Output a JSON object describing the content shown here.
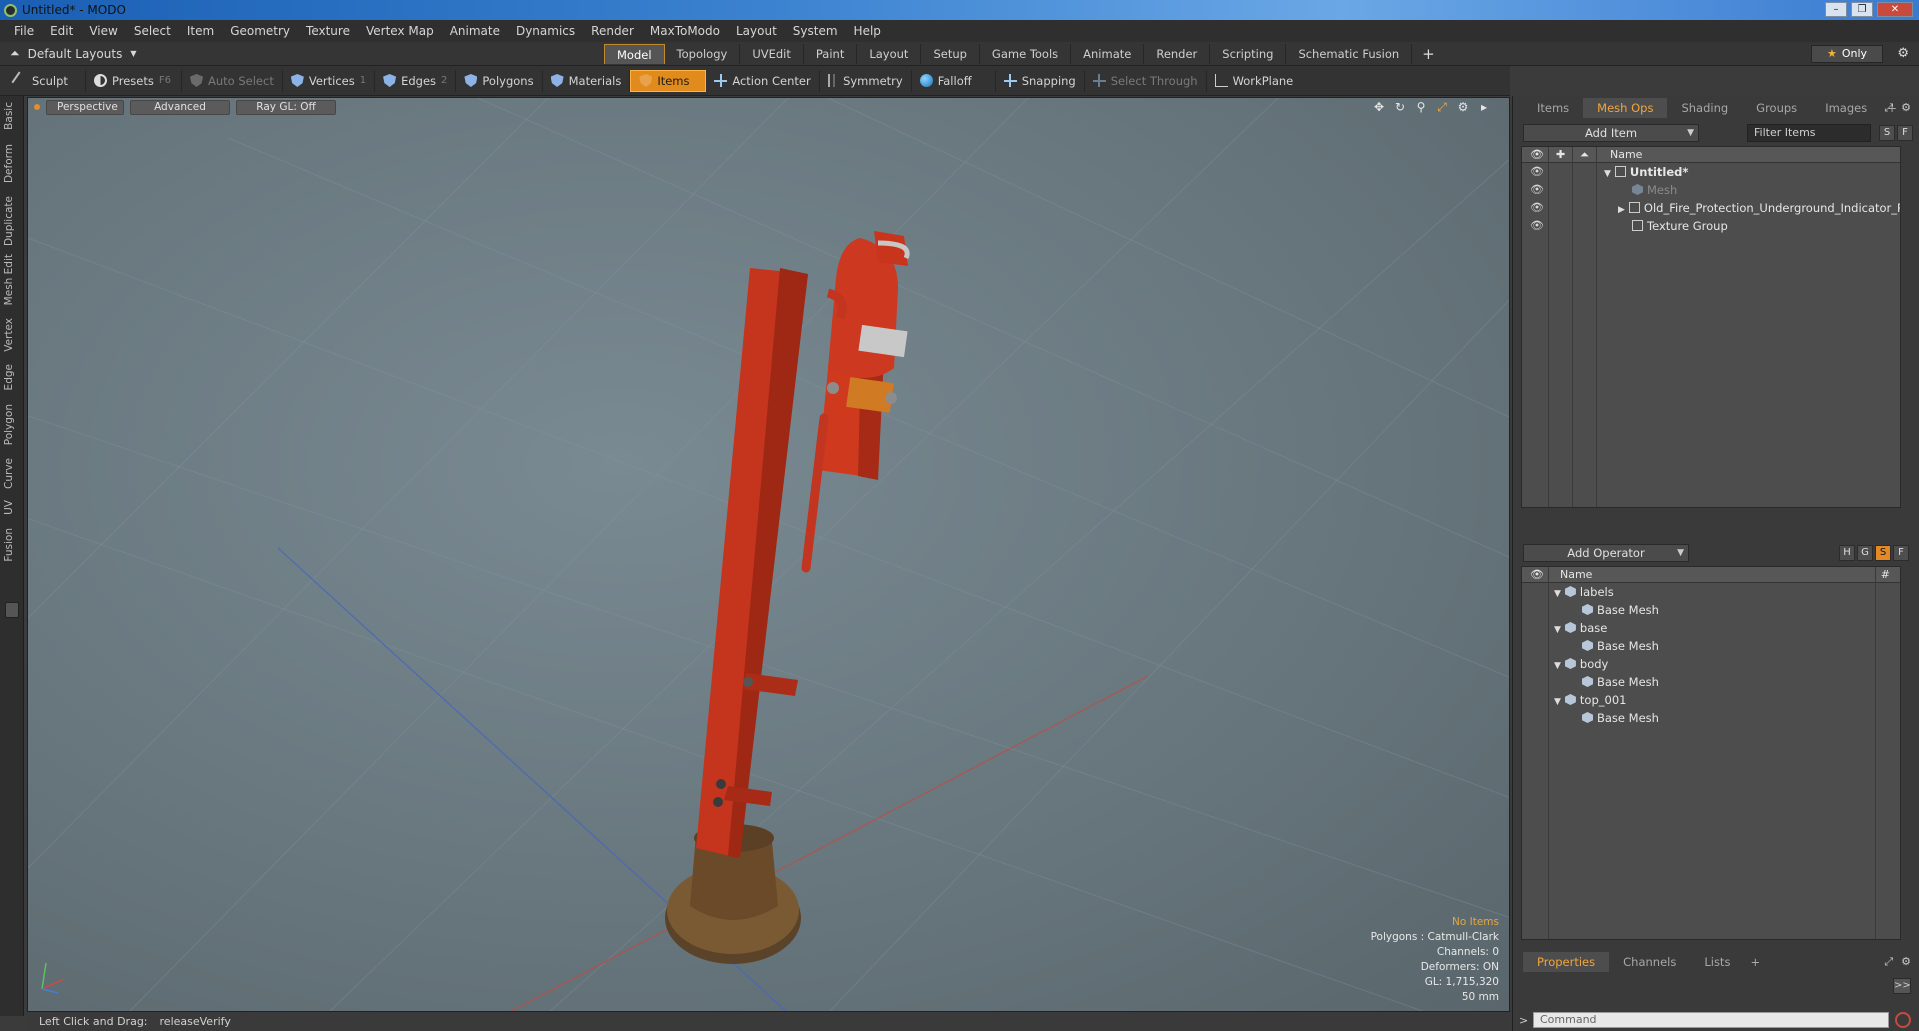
{
  "window": {
    "title": "Untitled* - MODO"
  },
  "menu": [
    "File",
    "Edit",
    "View",
    "Select",
    "Item",
    "Geometry",
    "Texture",
    "Vertex Map",
    "Animate",
    "Dynamics",
    "Render",
    "MaxToModo",
    "Layout",
    "System",
    "Help"
  ],
  "layouts": {
    "label": "Default Layouts"
  },
  "tabs": [
    "Model",
    "Topology",
    "UVEdit",
    "Paint",
    "Layout",
    "Setup",
    "Game Tools",
    "Animate",
    "Render",
    "Scripting",
    "Schematic Fusion"
  ],
  "only_label": "Only",
  "toolbar": {
    "sculpt": "Sculpt",
    "presets": "Presets",
    "presets_key": "F6",
    "auto_select": "Auto Select",
    "vertices": "Vertices",
    "vertices_key": "1",
    "edges": "Edges",
    "edges_key": "2",
    "polygons": "Polygons",
    "materials": "Materials",
    "items": "Items",
    "action_center": "Action Center",
    "symmetry": "Symmetry",
    "falloff": "Falloff",
    "snapping": "Snapping",
    "select_through": "Select Through",
    "workplane": "WorkPlane"
  },
  "left_tabs": [
    "Basic",
    "Deform",
    "Duplicate",
    "Mesh Edit",
    "Vertex",
    "Edge",
    "Polygon",
    "Curve",
    "UV",
    "Fusion"
  ],
  "viewport": {
    "view": "Perspective",
    "shading": "Advanced",
    "raygl": "Ray GL: Off",
    "info": {
      "no_items": "No Items",
      "polygons": "Polygons : Catmull-Clark",
      "channels": "Channels: 0",
      "deformers": "Deformers: ON",
      "gl": "GL: 1,715,320",
      "focal": "50 mm"
    }
  },
  "status": {
    "hint": "Left Click and Drag:",
    "action": "releaseVerify"
  },
  "items_panel": {
    "tabs": [
      "Items",
      "Mesh Ops",
      "Shading",
      "Groups",
      "Images"
    ],
    "active_tab": "Mesh Ops",
    "add_item": "Add Item",
    "filter": "Filter Items",
    "s_btn": "S",
    "f_btn": "F",
    "col_name": "Name",
    "rows": [
      {
        "label": "Untitled*",
        "bold": true
      },
      {
        "label": "Mesh",
        "dim": true
      },
      {
        "label": "Old_Fire_Protection_Underground_Indicator_Pos..."
      },
      {
        "label": "Texture Group"
      }
    ]
  },
  "ops_panel": {
    "add_operator": "Add Operator",
    "btns": [
      "H",
      "G",
      "S",
      "F"
    ],
    "col_name": "Name",
    "col_hash": "#",
    "rows": [
      {
        "label": "labels",
        "group": true
      },
      {
        "label": "Base Mesh"
      },
      {
        "label": "base",
        "group": true
      },
      {
        "label": "Base Mesh"
      },
      {
        "label": "body",
        "group": true
      },
      {
        "label": "Base Mesh"
      },
      {
        "label": "top_001",
        "group": true
      },
      {
        "label": "Base Mesh"
      }
    ]
  },
  "props_panel": {
    "tabs": [
      "Properties",
      "Channels",
      "Lists"
    ],
    "active_tab": "Properties"
  },
  "command": {
    "placeholder": "Command"
  },
  "colors": {
    "accent": "#e28b1d",
    "hydrant": "#c8321c"
  }
}
